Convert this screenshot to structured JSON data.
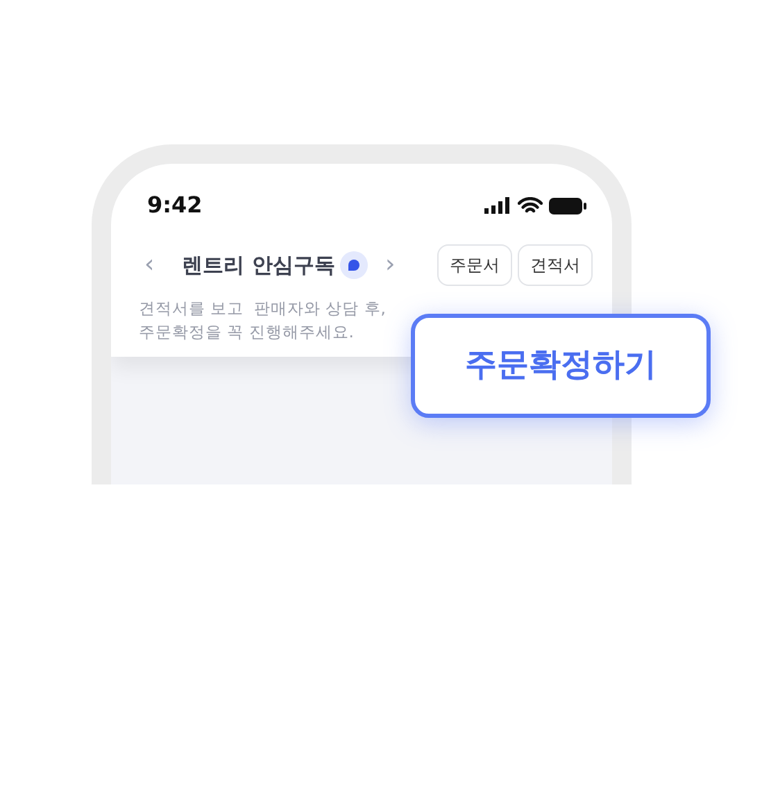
{
  "status_bar": {
    "time": "9:42"
  },
  "header": {
    "prev": "‹",
    "title": "렌트리 안심구독",
    "next": "›",
    "buttons": [
      "주문서",
      "견적서"
    ]
  },
  "description_lines": [
    "견적서를 보고  판매자와 상담 후,",
    "주문확정을 꼭 진행해주세요."
  ],
  "callout": {
    "label": "주문확정하기"
  }
}
